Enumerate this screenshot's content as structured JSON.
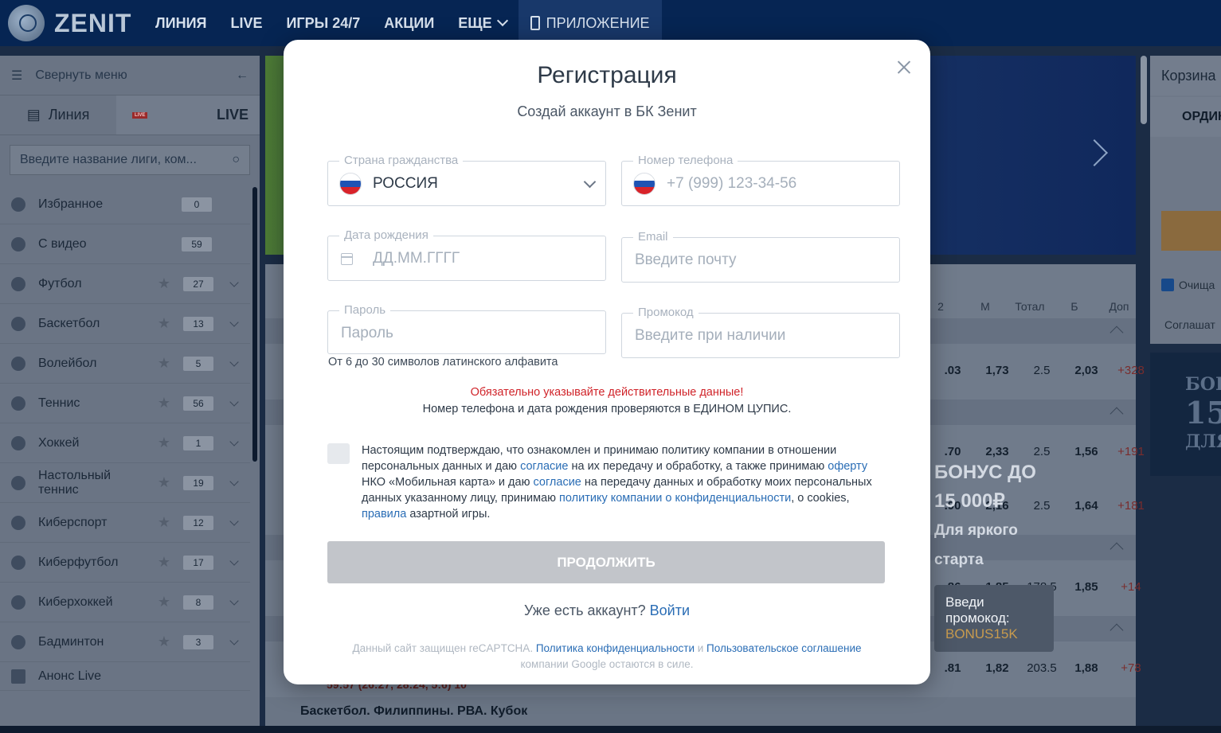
{
  "header": {
    "logo_text": "ZENIT",
    "nav": [
      "ЛИНИЯ",
      "LIVE",
      "ИГРЫ 24/7",
      "АКЦИИ",
      "ЕЩЕ"
    ],
    "app_label": "ПРИЛОЖЕНИЕ"
  },
  "sidebar": {
    "collapse_label": "Свернуть меню",
    "tab_line": "Линия",
    "tab_live": "LIVE",
    "live_badge": "LIVE",
    "search_placeholder": "Введите название лиги, ком...",
    "items": [
      {
        "label": "Избранное",
        "count": "0",
        "icon": "star-icon"
      },
      {
        "label": "С видео",
        "count": "59",
        "icon": "video-icon"
      },
      {
        "label": "Футбол",
        "count": "27",
        "icon": "football-icon"
      },
      {
        "label": "Баскетбол",
        "count": "13",
        "icon": "basketball-icon"
      },
      {
        "label": "Волейбол",
        "count": "5",
        "icon": "volleyball-icon"
      },
      {
        "label": "Теннис",
        "count": "56",
        "icon": "tennis-icon"
      },
      {
        "label": "Хоккей",
        "count": "1",
        "icon": "hockey-icon"
      },
      {
        "label": "Настольный теннис",
        "count": "19",
        "icon": "table-tennis-icon"
      },
      {
        "label": "Киберспорт",
        "count": "12",
        "icon": "gamepad-icon"
      },
      {
        "label": "Киберфутбол",
        "count": "17",
        "icon": "gamepad-icon"
      },
      {
        "label": "Киберхоккей",
        "count": "8",
        "icon": "gamepad-icon"
      },
      {
        "label": "Бадминтон",
        "count": "3",
        "icon": "badminton-icon"
      }
    ],
    "anons_live": "Анонс Live"
  },
  "table": {
    "headers": [
      "2",
      "М",
      "Тотал",
      "Б",
      "Доп"
    ],
    "rows": [
      [
        ".03",
        "1,73",
        "2.5",
        "2,03",
        "+328"
      ],
      [
        ".70",
        "2,33",
        "2.5",
        "1,56",
        "+191"
      ],
      [
        ".90",
        "2,16",
        "2.5",
        "1,64",
        "+181"
      ],
      [
        ".86",
        "1,85",
        "178.5",
        "1,85",
        "+14"
      ],
      [
        ".81",
        "1,82",
        "203.5",
        "1,88",
        "+78"
      ]
    ],
    "score_line": "59:57 (26:27, 28:24, 5:6) 10",
    "bottom_section": "Баскетбол. Филиппины. РВА. Кубок"
  },
  "promo": {
    "line1": "БОНУС ДО",
    "line2": "15 000₽",
    "line3": "Для яркого",
    "line4": "старта",
    "box_label": "Введи промокод:",
    "code": "BONUS15K"
  },
  "right_panel": {
    "title": "Корзина",
    "tab": "ОРДИН",
    "clear_label": "Очища",
    "agree_label": "Соглашат",
    "promo_text": [
      "БОН",
      "15",
      "ДЛЯ"
    ]
  },
  "modal": {
    "title": "Регистрация",
    "subtitle": "Создай аккаунт в БК Зенит",
    "country_label": "Страна гражданства",
    "country_value": "РОССИЯ",
    "phone_label": "Номер телефона",
    "phone_placeholder": "+7 (999) 123-34-56",
    "birth_label": "Дата рождения",
    "birth_placeholder": "ДД.ММ.ГГГГ",
    "email_label": "Email",
    "email_placeholder": "Введите почту",
    "password_label": "Пароль",
    "password_placeholder": "Пароль",
    "password_hint": "От 6 до 30 символов латинского алфавита",
    "promo_label": "Промокод",
    "promo_placeholder": "Введите при наличии",
    "warning": "Обязательно указывайте действительные данные!",
    "warning_note": "Номер телефона и дата рождения проверяются в ЕДИНОМ ЦУПИС.",
    "agree": {
      "t1": "Настоящим подтверждаю, что ознакомлен и принимаю политику компании в отношении персональных данных и даю ",
      "l1": "согласие",
      "t2": " на их передачу и обработку, а также принимаю ",
      "l2": "оферту",
      "t3": " НКО «Мобильная карта» и даю ",
      "l3": "согласие",
      "t4": " на передачу данных и обработку моих персональных данных указанному лицу, принимаю ",
      "l4": "политику компании о конфиденциальности",
      "t5": ", о cookies, ",
      "l5": "правила",
      "t6": " азартной игры."
    },
    "continue_label": "ПРОДОЛЖИТЬ",
    "have_account": "Уже есть аккаунт?",
    "login_link": "Войти",
    "captcha": {
      "t1": "Данный сайт защищен reCAPTCHA. ",
      "l1": "Политика конфиденциальности",
      "t2": " и ",
      "l2": "Пользовательское соглашение",
      "t3": " компании Google остаются в силе."
    }
  },
  "colors": {
    "header_bg": "#062553",
    "link": "#2a6db5",
    "warning": "#d0242a",
    "button_disabled": "#c2c5ca"
  }
}
